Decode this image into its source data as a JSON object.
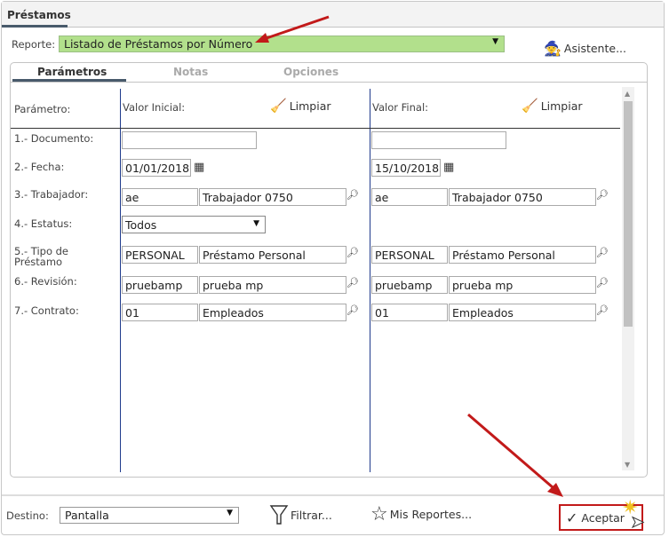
{
  "window": {
    "tab": "Préstamos"
  },
  "reporte": {
    "label": "Reporte:",
    "value": "Listado de Préstamos por Número",
    "asistente": "Asistente..."
  },
  "tabs": [
    "Parámetros",
    "Notas",
    "Opciones"
  ],
  "headers": {
    "param": "Parámetro:",
    "inicial": "Valor Inicial:",
    "final": "Valor Final:",
    "limpiar": "Limpiar"
  },
  "params": [
    {
      "label": "1.- Documento:"
    },
    {
      "label": "2.- Fecha:",
      "ini": "01/01/2018",
      "fin": "15/10/2018"
    },
    {
      "label": "3.- Trabajador:",
      "ini_code": "ae",
      "ini_desc": "Trabajador 0750",
      "fin_code": "ae",
      "fin_desc": "Trabajador 0750"
    },
    {
      "label": "4.- Estatus:",
      "ini": "Todos"
    },
    {
      "label": "5.- Tipo de Préstamo",
      "ini_code": "PERSONAL",
      "ini_desc": "Préstamo Personal",
      "fin_code": "PERSONAL",
      "fin_desc": "Préstamo Personal"
    },
    {
      "label": "6.- Revisión:",
      "ini_code": "pruebamp",
      "ini_desc": "prueba mp",
      "fin_code": "pruebamp",
      "fin_desc": "prueba mp"
    },
    {
      "label": "7.- Contrato:",
      "ini_code": "01",
      "ini_desc": "Empleados",
      "fin_code": "01",
      "fin_desc": "Empleados"
    }
  ],
  "footer": {
    "destino_label": "Destino:",
    "destino": "Pantalla",
    "filtrar": "Filtrar...",
    "mis_reportes": "Mis Reportes...",
    "aceptar": "Aceptar"
  },
  "colors": {
    "accent": "#b2e08c",
    "highlight": "#c21a1a",
    "divider": "#1f3b8c"
  }
}
